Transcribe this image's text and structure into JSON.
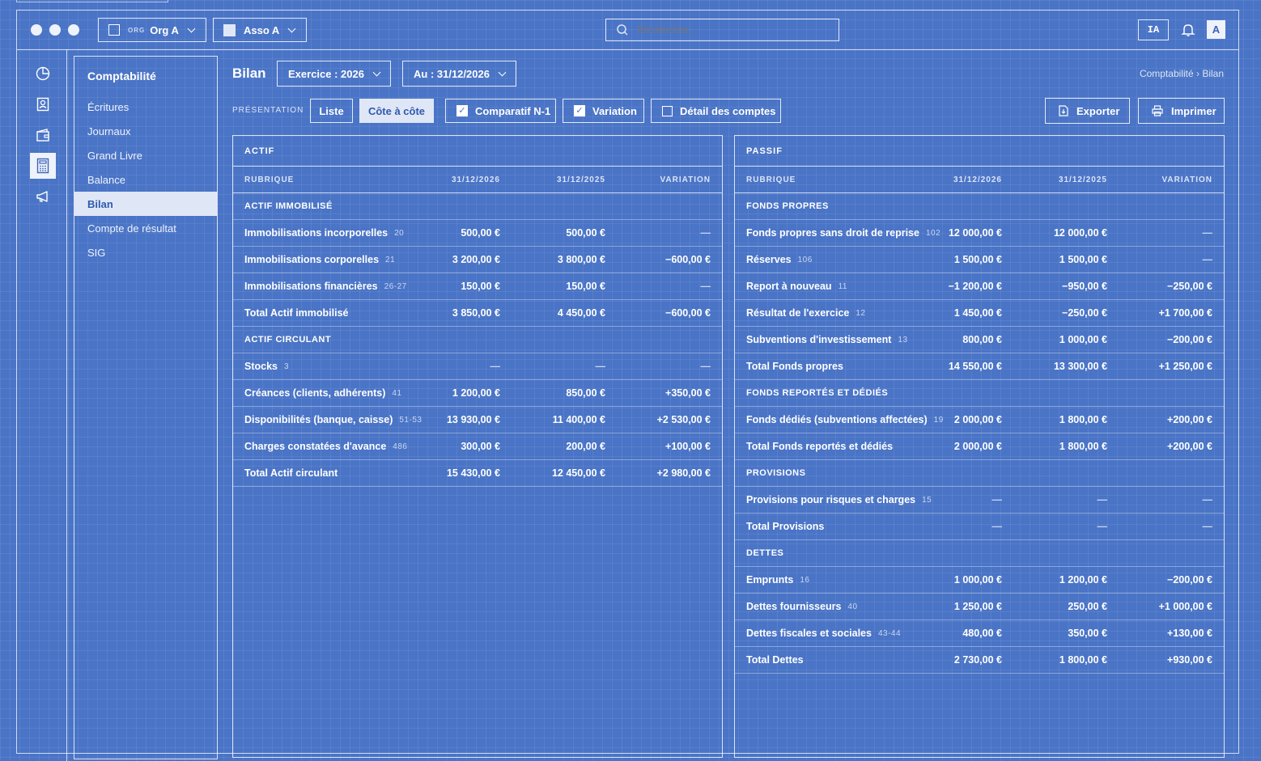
{
  "titlebar": {
    "org_badge": "ORG",
    "org_name": "Org A",
    "asso_name": "Asso A",
    "search_placeholder": "Rechercher...",
    "ai_label": "IA",
    "avatar_initial": "A"
  },
  "rail": {
    "icons": [
      "dashboard-icon",
      "contacts-icon",
      "wallet-icon",
      "calculator-icon",
      "megaphone-icon"
    ],
    "active_index": 3
  },
  "sidebar": {
    "title": "Comptabilité",
    "items": [
      {
        "label": "Écritures"
      },
      {
        "label": "Journaux"
      },
      {
        "label": "Grand Livre"
      },
      {
        "label": "Balance"
      },
      {
        "label": "Bilan",
        "active": true
      },
      {
        "label": "Compte de résultat"
      },
      {
        "label": "SIG"
      }
    ]
  },
  "page": {
    "title": "Bilan",
    "exercice": "Exercice : 2026",
    "au": "Au : 31/12/2026",
    "breadcrumb": "Comptabilité › Bilan"
  },
  "toolbar": {
    "presentation_label": "PRÉSENTATION",
    "liste": "Liste",
    "cote_a_cote": "Côte à côte",
    "comparatif": "Comparatif N-1",
    "comparatif_checked": true,
    "variation": "Variation",
    "variation_checked": true,
    "detail": "Détail des comptes",
    "detail_checked": false,
    "exporter": "Exporter",
    "imprimer": "Imprimer"
  },
  "actif": {
    "title": "ACTIF",
    "columns": [
      "RUBRIQUE",
      "31/12/2026",
      "31/12/2025",
      "VARIATION"
    ],
    "rows": [
      {
        "type": "section",
        "label": "ACTIF IMMOBILISÉ"
      },
      {
        "type": "item",
        "label": "Immobilisations incorporelles",
        "code": "20",
        "n": "500,00 €",
        "n1": "500,00 €",
        "var": "—"
      },
      {
        "type": "item",
        "label": "Immobilisations corporelles",
        "code": "21",
        "n": "3 200,00 €",
        "n1": "3 800,00 €",
        "var": "−600,00 €"
      },
      {
        "type": "item",
        "label": "Immobilisations financières",
        "code": "26-27",
        "n": "150,00 €",
        "n1": "150,00 €",
        "var": "—"
      },
      {
        "type": "total",
        "label": "Total Actif immobilisé",
        "code": "",
        "n": "3 850,00 €",
        "n1": "4 450,00 €",
        "var": "−600,00 €"
      },
      {
        "type": "section",
        "label": "ACTIF CIRCULANT"
      },
      {
        "type": "item",
        "label": "Stocks",
        "code": "3",
        "n": "—",
        "n1": "—",
        "var": "—"
      },
      {
        "type": "item",
        "label": "Créances (clients, adhérents)",
        "code": "41",
        "n": "1 200,00 €",
        "n1": "850,00 €",
        "var": "+350,00 €"
      },
      {
        "type": "item",
        "label": "Disponibilités (banque, caisse)",
        "code": "51-53",
        "n": "13 930,00 €",
        "n1": "11 400,00 €",
        "var": "+2 530,00 €"
      },
      {
        "type": "item",
        "label": "Charges constatées d'avance",
        "code": "486",
        "n": "300,00 €",
        "n1": "200,00 €",
        "var": "+100,00 €"
      },
      {
        "type": "total",
        "label": "Total Actif circulant",
        "code": "",
        "n": "15 430,00 €",
        "n1": "12 450,00 €",
        "var": "+2 980,00 €"
      }
    ]
  },
  "passif": {
    "title": "PASSIF",
    "columns": [
      "RUBRIQUE",
      "31/12/2026",
      "31/12/2025",
      "VARIATION"
    ],
    "rows": [
      {
        "type": "section",
        "label": "FONDS PROPRES"
      },
      {
        "type": "item",
        "label": "Fonds propres sans droit de reprise",
        "code": "102",
        "n": "12 000,00 €",
        "n1": "12 000,00 €",
        "var": "—"
      },
      {
        "type": "item",
        "label": "Réserves",
        "code": "106",
        "n": "1 500,00 €",
        "n1": "1 500,00 €",
        "var": "—"
      },
      {
        "type": "item",
        "label": "Report à nouveau",
        "code": "11",
        "n": "−1 200,00 €",
        "n1": "−950,00 €",
        "var": "−250,00 €"
      },
      {
        "type": "item",
        "label": "Résultat de l'exercice",
        "code": "12",
        "n": "1 450,00 €",
        "n1": "−250,00 €",
        "var": "+1 700,00 €"
      },
      {
        "type": "item",
        "label": "Subventions d'investissement",
        "code": "13",
        "n": "800,00 €",
        "n1": "1 000,00 €",
        "var": "−200,00 €"
      },
      {
        "type": "total",
        "label": "Total Fonds propres",
        "code": "",
        "n": "14 550,00 €",
        "n1": "13 300,00 €",
        "var": "+1 250,00 €"
      },
      {
        "type": "section",
        "label": "FONDS REPORTÉS ET DÉDIÉS"
      },
      {
        "type": "item",
        "label": "Fonds dédiés (subventions affectées)",
        "code": "19",
        "n": "2 000,00 €",
        "n1": "1 800,00 €",
        "var": "+200,00 €"
      },
      {
        "type": "total",
        "label": "Total Fonds reportés et dédiés",
        "code": "",
        "n": "2 000,00 €",
        "n1": "1 800,00 €",
        "var": "+200,00 €"
      },
      {
        "type": "section",
        "label": "PROVISIONS"
      },
      {
        "type": "item",
        "label": "Provisions pour risques et charges",
        "code": "15",
        "n": "—",
        "n1": "—",
        "var": "—"
      },
      {
        "type": "total",
        "label": "Total Provisions",
        "code": "",
        "n": "—",
        "n1": "—",
        "var": "—"
      },
      {
        "type": "section",
        "label": "DETTES"
      },
      {
        "type": "item",
        "label": "Emprunts",
        "code": "16",
        "n": "1 000,00 €",
        "n1": "1 200,00 €",
        "var": "−200,00 €"
      },
      {
        "type": "item",
        "label": "Dettes fournisseurs",
        "code": "40",
        "n": "1 250,00 €",
        "n1": "250,00 €",
        "var": "+1 000,00 €"
      },
      {
        "type": "item",
        "label": "Dettes fiscales et sociales",
        "code": "43-44",
        "n": "480,00 €",
        "n1": "350,00 €",
        "var": "+130,00 €"
      },
      {
        "type": "total",
        "label": "Total Dettes",
        "code": "",
        "n": "2 730,00 €",
        "n1": "1 800,00 €",
        "var": "+930,00 €"
      }
    ]
  }
}
